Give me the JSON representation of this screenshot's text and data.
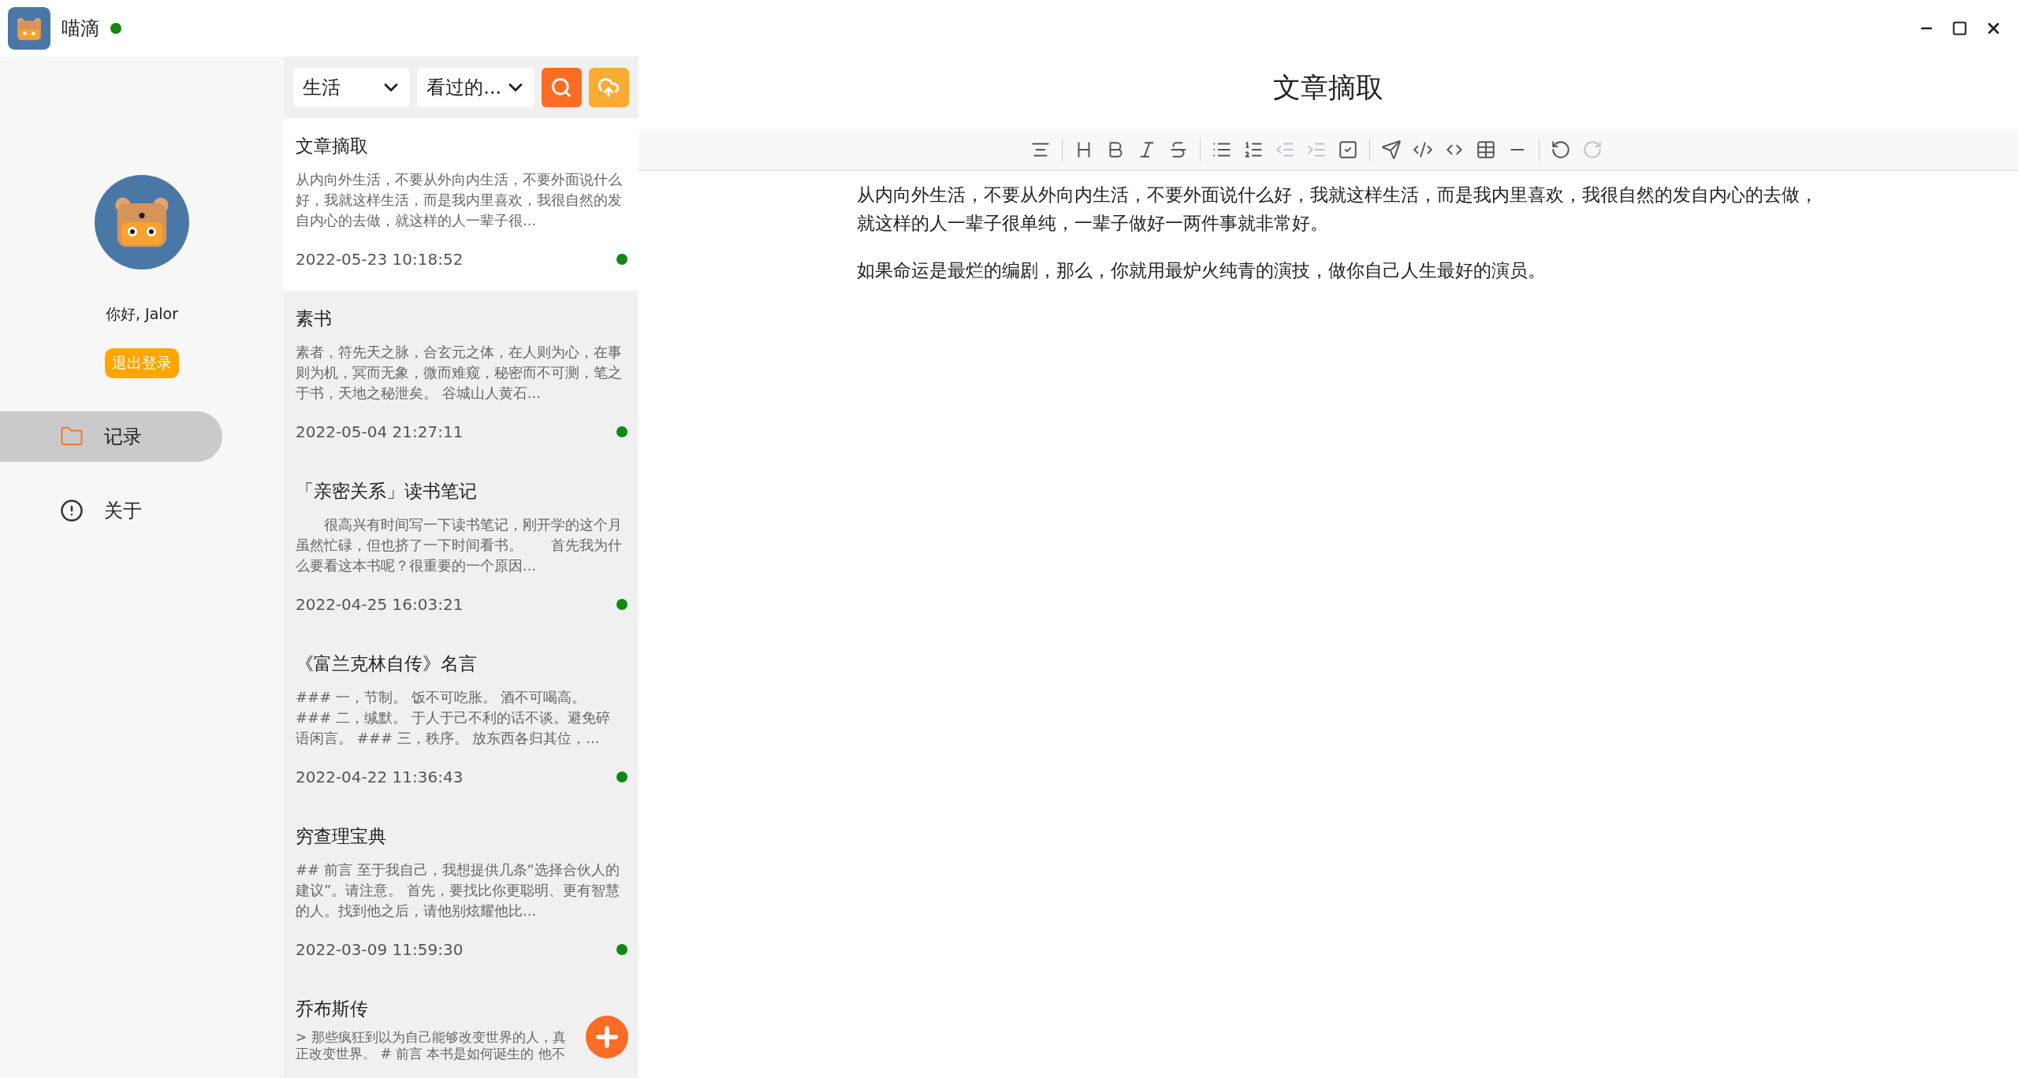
{
  "window": {
    "title": "喵滴",
    "online": true
  },
  "sidebar": {
    "greeting": "你好, Jalor",
    "logout": "退出登录",
    "items": [
      {
        "kind": "records",
        "label": "记录",
        "selected": true
      },
      {
        "kind": "about",
        "label": "关于",
        "selected": false
      }
    ]
  },
  "filters": {
    "category": "生活",
    "scope": "看过的..."
  },
  "notes": [
    {
      "title": "文章摘取",
      "preview": "从内向外生活，不要从外向内生活，不要外面说什么好，我就这样生活，而是我内里喜欢，我很自然的发自内心的去做，就这样的人一辈子很...",
      "date": "2022-05-23 10:18:52",
      "synced": true,
      "selected": true
    },
    {
      "title": "素书",
      "preview": "素者，符先天之脉，合玄元之体，在人则为心，在事则为机，冥而无象，微而难窥，秘密而不可测，笔之于书，天地之秘泄矣。 谷城山人黄石...",
      "date": "2022-05-04 21:27:11",
      "synced": true,
      "selected": false
    },
    {
      "title": "「亲密关系」读书笔记",
      "preview": "　　很高兴有时间写一下读书笔记，刚开学的这个月虽然忙碌，但也挤了一下时间看书。　　首先我为什么要看这本书呢？很重要的一个原因...",
      "date": "2022-04-25 16:03:21",
      "synced": true,
      "selected": false
    },
    {
      "title": "《富兰克林自传》名言",
      "preview": "### 一，节制。 饭不可吃胀。 酒不可喝高。 ### 二，缄默。 于人于己不利的话不谈。避免碎语闲言。 ### 三，秩序。 放东西各归其位，...",
      "date": "2022-04-22 11:36:43",
      "synced": true,
      "selected": false
    },
    {
      "title": "穷查理宝典",
      "preview": "## 前言 至于我自己，我想提供几条“选择合伙人的建议”。请注意。 首先，要找比你更聪明、更有智慧的人。找到他之后，请他别炫耀他比...",
      "date": "2022-03-09 11:59:30",
      "synced": true,
      "selected": false
    },
    {
      "title": "乔布斯传",
      "preview": "> 那些疯狂到以为自己能够改变世界的人，真正改变世界。 # 前言 本书是如何诞生的 他不",
      "selected": false
    }
  ],
  "editor": {
    "title": "文章摘取",
    "toolbar": [
      [
        {
          "kind": "align",
          "disabled": false
        }
      ],
      [
        {
          "kind": "heading",
          "disabled": false
        },
        {
          "kind": "bold",
          "disabled": false
        },
        {
          "kind": "italic",
          "disabled": false
        },
        {
          "kind": "strike",
          "disabled": false
        }
      ],
      [
        {
          "kind": "bullets",
          "disabled": false
        },
        {
          "kind": "numbers",
          "disabled": false
        },
        {
          "kind": "outdent",
          "disabled": true
        },
        {
          "kind": "indent",
          "disabled": true
        },
        {
          "kind": "check",
          "disabled": false
        }
      ],
      [
        {
          "kind": "quote",
          "disabled": false
        },
        {
          "kind": "codeblock",
          "disabled": false
        },
        {
          "kind": "inlinecode",
          "disabled": false
        },
        {
          "kind": "table",
          "disabled": false
        },
        {
          "kind": "rule",
          "disabled": false
        }
      ],
      [
        {
          "kind": "undo",
          "disabled": false
        },
        {
          "kind": "redo",
          "disabled": true
        }
      ]
    ],
    "paragraphs": [
      "从内向外生活，不要从外向内生活，不要外面说什么好，我就这样生活，而是我内里喜欢，我很自然的发自内心的去做，就这样的人一辈子很单纯，一辈子做好一两件事就非常好。",
      "如果命运是最烂的编剧，那么，你就用最炉火纯青的演技，做你自己人生最好的演员。"
    ]
  }
}
